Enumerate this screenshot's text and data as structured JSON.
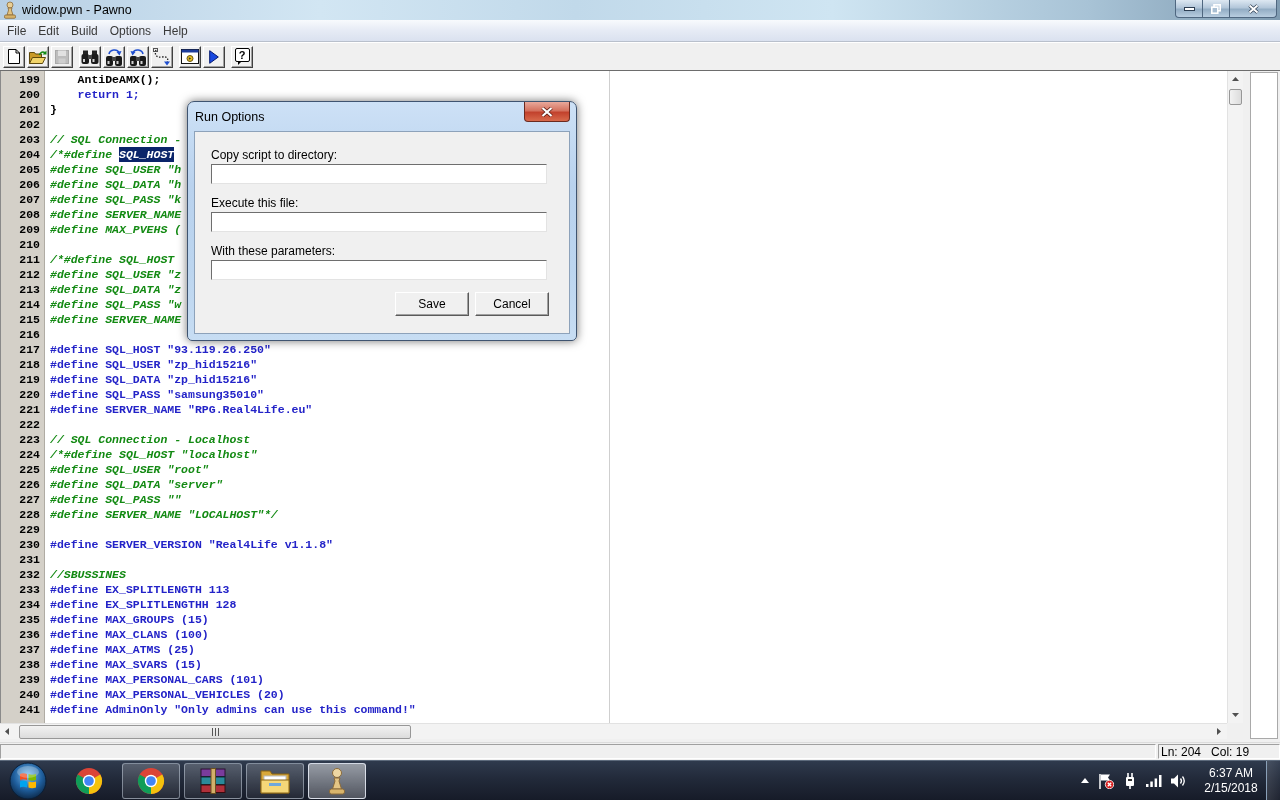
{
  "window": {
    "title": "widow.pwn - Pawno"
  },
  "menu": [
    "File",
    "Edit",
    "Build",
    "Options",
    "Help"
  ],
  "toolbar_groups": [
    [
      {
        "kind": "new",
        "disabled": false
      },
      {
        "kind": "open",
        "disabled": false
      },
      {
        "kind": "save",
        "disabled": true
      }
    ],
    [
      {
        "kind": "find",
        "disabled": false
      },
      {
        "kind": "findnext",
        "disabled": false
      },
      {
        "kind": "replace",
        "disabled": false
      },
      {
        "kind": "goto",
        "disabled": false
      }
    ],
    [
      {
        "kind": "compile",
        "disabled": false
      },
      {
        "kind": "run",
        "disabled": false
      }
    ],
    [
      {
        "kind": "help",
        "disabled": false,
        "label": "?"
      }
    ]
  ],
  "editor": {
    "lines": [
      {
        "number": "199",
        "kind": "plain",
        "text": "    AntiDeAMX();"
      },
      {
        "number": "200",
        "kind": "keyword",
        "text": "    return 1;"
      },
      {
        "number": "201",
        "kind": "plain",
        "text": "}"
      },
      {
        "number": "202"
      },
      {
        "number": "203",
        "kind": "comment",
        "text": "// SQL Connection -"
      },
      {
        "number": "204",
        "kind": "comment",
        "text": "/*#define ",
        "selection": "SQL_HOST"
      },
      {
        "number": "205",
        "kind": "comment",
        "text": "#define SQL_USER \"h"
      },
      {
        "number": "206",
        "kind": "comment",
        "text": "#define SQL_DATA \"h"
      },
      {
        "number": "207",
        "kind": "comment",
        "text": "#define SQL_PASS \"k"
      },
      {
        "number": "208",
        "kind": "comment",
        "text": "#define SERVER_NAME"
      },
      {
        "number": "209",
        "kind": "comment",
        "text": "#define MAX_PVEHS ("
      },
      {
        "number": "210"
      },
      {
        "number": "211",
        "kind": "comment",
        "text": "/*#define SQL_HOST"
      },
      {
        "number": "212",
        "kind": "comment",
        "text": "#define SQL_USER \"z"
      },
      {
        "number": "213",
        "kind": "comment",
        "text": "#define SQL_DATA \"z"
      },
      {
        "number": "214",
        "kind": "comment",
        "text": "#define SQL_PASS \"w"
      },
      {
        "number": "215",
        "kind": "comment",
        "text": "#define SERVER_NAME"
      },
      {
        "number": "216"
      },
      {
        "number": "217",
        "kind": "keyword",
        "text": "#define SQL_HOST \"93.119.26.250\""
      },
      {
        "number": "218",
        "kind": "keyword",
        "text": "#define SQL_USER \"zp_hid15216\""
      },
      {
        "number": "219",
        "kind": "keyword",
        "text": "#define SQL_DATA \"zp_hid15216\""
      },
      {
        "number": "220",
        "kind": "keyword",
        "text": "#define SQL_PASS \"samsung35010\""
      },
      {
        "number": "221",
        "kind": "keyword",
        "text": "#define SERVER_NAME \"RPG.Real4Life.eu\""
      },
      {
        "number": "222"
      },
      {
        "number": "223",
        "kind": "comment",
        "text": "// SQL Connection - Localhost"
      },
      {
        "number": "224",
        "kind": "comment",
        "text": "/*#define SQL_HOST \"localhost\""
      },
      {
        "number": "225",
        "kind": "comment",
        "text": "#define SQL_USER \"root\""
      },
      {
        "number": "226",
        "kind": "comment",
        "text": "#define SQL_DATA \"server\""
      },
      {
        "number": "227",
        "kind": "comment",
        "text": "#define SQL_PASS \"\""
      },
      {
        "number": "228",
        "kind": "comment",
        "text": "#define SERVER_NAME \"LOCALHOST\"*/"
      },
      {
        "number": "229"
      },
      {
        "number": "230",
        "kind": "keyword",
        "text": "#define SERVER_VERSION \"Real4Life v1.1.8\""
      },
      {
        "number": "231"
      },
      {
        "number": "232",
        "kind": "comment",
        "text": "//SBUSSINES"
      },
      {
        "number": "233",
        "kind": "keyword",
        "text": "#define EX_SPLITLENGTH 113"
      },
      {
        "number": "234",
        "kind": "keyword",
        "text": "#define EX_SPLITLENGTHH 128"
      },
      {
        "number": "235",
        "kind": "keyword",
        "text": "#define MAX_GROUPS (15)"
      },
      {
        "number": "236",
        "kind": "keyword",
        "text": "#define MAX_CLANS (100)"
      },
      {
        "number": "237",
        "kind": "keyword",
        "text": "#define MAX_ATMS (25)"
      },
      {
        "number": "238",
        "kind": "keyword",
        "text": "#define MAX_SVARS (15)"
      },
      {
        "number": "239",
        "kind": "keyword",
        "text": "#define MAX_PERSONAL_CARS (101)"
      },
      {
        "number": "240",
        "kind": "keyword",
        "text": "#define MAX_PERSONAL_VEHICLES (20)"
      },
      {
        "number": "241",
        "kind": "keyword",
        "text": "#define AdminOnly \"Only admins can use this command!\""
      }
    ]
  },
  "dialog": {
    "title": "Run Options",
    "fields": [
      {
        "label": "Copy script to directory:"
      },
      {
        "label": "Execute this file:"
      },
      {
        "label": "With these parameters:"
      }
    ],
    "buttons": [
      "Save",
      "Cancel"
    ]
  },
  "status_bar": {
    "line": "Ln: 204",
    "column": "Col: 19"
  },
  "taskbar": {
    "apps": [
      {
        "kind": "browser",
        "running": false,
        "selected": false
      },
      {
        "kind": "browser",
        "running": true,
        "selected": false
      },
      {
        "kind": "archive",
        "running": true,
        "selected": false
      },
      {
        "kind": "folder",
        "running": true,
        "selected": false
      },
      {
        "kind": "pawn",
        "running": true,
        "selected": true
      }
    ],
    "clock": {
      "time": "6:37 AM",
      "date": "2/15/2018"
    }
  }
}
